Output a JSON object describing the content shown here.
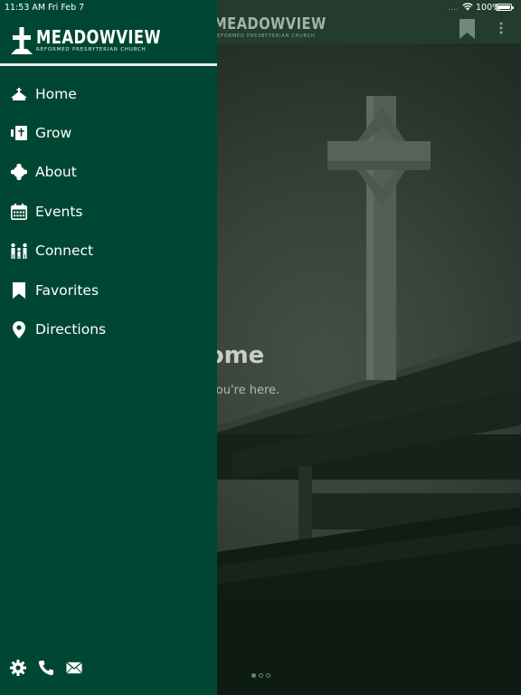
{
  "status_bar": {
    "time": "11:53 AM",
    "date": "Fri Feb 7",
    "signal_text": "....",
    "battery_percent_label": "100%",
    "battery_level": 1.0
  },
  "brand": {
    "name": "MEADOWVIEW",
    "subtitle": "REFORMED PRESBYTERIAN CHURCH",
    "drawer_color": "#004733"
  },
  "hero": {
    "title": "Welcome",
    "subtitle": "We're glad you're here."
  },
  "menu": [
    {
      "label": "Home",
      "icon": "church-icon"
    },
    {
      "label": "Grow",
      "icon": "bible-icon"
    },
    {
      "label": "About",
      "icon": "celtic-cross-icon"
    },
    {
      "label": "Events",
      "icon": "calendar-icon"
    },
    {
      "label": "Connect",
      "icon": "people-icon"
    },
    {
      "label": "Favorites",
      "icon": "bookmark-icon"
    },
    {
      "label": "Directions",
      "icon": "location-pin-icon"
    }
  ],
  "footer_icons": [
    "settings-icon",
    "phone-icon",
    "mail-icon"
  ],
  "pager": {
    "pages": 3,
    "current": 1
  }
}
